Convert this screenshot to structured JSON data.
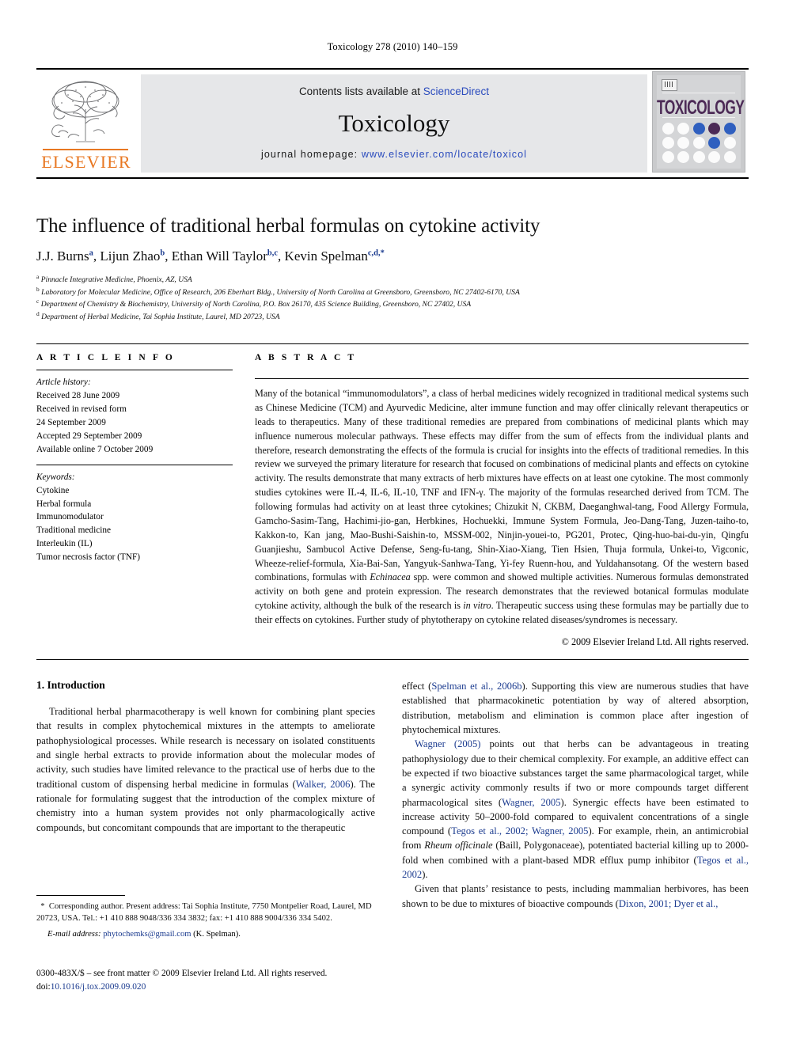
{
  "running_head": "Toxicology 278 (2010) 140–159",
  "masthead": {
    "contents_prefix": "Contents lists available at ",
    "sciencedirect": "ScienceDirect",
    "journal_title": "Toxicology",
    "homepage_prefix": "journal homepage:",
    "homepage_url": "www.elsevier.com/locate/toxicol",
    "publisher_logo_text": "ELSEVIER",
    "cover_title": "TOXICOLOGY",
    "accent_orange": "#E87722",
    "link_blue": "#2a4bbd",
    "cover_plum": "#4c2a56",
    "cover_blue": "#2f5fbf"
  },
  "article": {
    "title": "The influence of traditional herbal formulas on cytokine activity",
    "authors": [
      {
        "name": "J.J. Burns",
        "sup": "a"
      },
      {
        "name": "Lijun Zhao",
        "sup": "b"
      },
      {
        "name": "Ethan Will Taylor",
        "sup": "b,c"
      },
      {
        "name": "Kevin Spelman",
        "sup": "c,d,*"
      }
    ],
    "affiliations": [
      {
        "sup": "a",
        "text": "Pinnacle Integrative Medicine, Phoenix, AZ, USA"
      },
      {
        "sup": "b",
        "text": "Laboratory for Molecular Medicine, Office of Research, 206 Eberhart Bldg., University of North Carolina at Greensboro, Greensboro, NC 27402-6170, USA"
      },
      {
        "sup": "c",
        "text": "Department of Chemistry & Biochemistry, University of North Carolina, P.O. Box 26170, 435 Science Building, Greensboro, NC 27402, USA"
      },
      {
        "sup": "d",
        "text": "Department of Herbal Medicine, Tai Sophia Institute, Laurel, MD 20723, USA"
      }
    ]
  },
  "article_info": {
    "label": "A R T I C L E    I N F O",
    "history_heading": "Article history:",
    "history": [
      "Received 28 June 2009",
      "Received in revised form",
      "24 September 2009",
      "Accepted 29 September 2009",
      "Available online 7 October 2009"
    ],
    "keywords_heading": "Keywords:",
    "keywords": [
      "Cytokine",
      "Herbal formula",
      "Immunomodulator",
      "Traditional medicine",
      "Interleukin (IL)",
      "Tumor necrosis factor (TNF)"
    ]
  },
  "abstract": {
    "label": "A B S T R A C T",
    "p1": "Many of the botanical “immunomodulators”, a class of herbal medicines widely recognized in traditional medical systems such as Chinese Medicine (TCM) and Ayurvedic Medicine, alter immune function and may offer clinically relevant therapeutics or leads to therapeutics. Many of these traditional remedies are prepared from combinations of medicinal plants which may influence numerous molecular pathways. These effects may differ from the sum of effects from the individual plants and therefore, research demonstrating the effects of the formula is crucial for insights into the effects of traditional remedies. In this review we surveyed the primary literature for research that focused on combinations of medicinal plants and effects on cytokine activity. The results demonstrate that many extracts of herb mixtures have effects on at least one cytokine. The most commonly studies cytokines were IL-4, IL-6, IL-10, TNF and IFN-γ. The majority of the formulas researched derived from TCM. The following formulas had activity on at least three cytokines; Chizukit N, CKBM, Daeganghwal-tang, Food Allergy Formula, Gamcho-Sasim-Tang, Hachimi-jio-gan, Herbkines, Hochuekki, Immune System Formula, Jeo-Dang-Tang, Juzen-taiho-to, Kakkon-to, Kan jang, Mao-Bushi-Saishin-to, MSSM-002, Ninjin-youei-to, PG201, Protec, Qing-huo-bai-du-yin, Qingfu Guanjieshu, Sambucol Active Defense, Seng-fu-tang, Shin-Xiao-Xiang, Tien Hsien, Thuja formula, Unkei-to, Vigconic, Wheeze-relief-formula, Xia-Bai-San, Yangyuk-Sanhwa-Tang, Yi-fey Ruenn-hou, and Yuldahansotang. Of the western based combinations, formulas with ",
    "p1_italic": "Echinacea",
    "p1b": " spp. were common and showed multiple activities. Numerous formulas demonstrated activity on both gene and protein expression. The research demonstrates that the reviewed botanical formulas modulate cytokine activity, although the bulk of the research is ",
    "p1_italic2": "in vitro",
    "p1c": ". Therapeutic success using these formulas may be partially due to their effects on cytokines. Further study of phytotherapy on cytokine related diseases/syndromes is necessary.",
    "copyright": "© 2009 Elsevier Ireland Ltd. All rights reserved."
  },
  "body": {
    "section_heading": "1.  Introduction",
    "left_p1_a": "Traditional herbal pharmacotherapy is well known for combining plant species that results in complex phytochemical mixtures in the attempts to ameliorate pathophysiological processes. While research is necessary on isolated constituents and single herbal extracts to provide information about the molecular modes of activity, such studies have limited relevance to the practical use of herbs due to the traditional custom of dispensing herbal medicine in formulas (",
    "left_ref1": "Walker, 2006",
    "left_p1_b": "). The rationale for formulating suggest that the introduction of the complex mixture of chemistry into a human system provides not only pharmacologically active compounds, but concomitant compounds that are important to the therapeutic",
    "right_p1_a": "effect (",
    "right_ref1": "Spelman et al., 2006b",
    "right_p1_b": "). Supporting this view are numerous studies that have established that pharmacokinetic potentiation by way of altered absorption, distribution, metabolism and elimination is common place after ingestion of phytochemical mixtures.",
    "right_ref2": "Wagner (2005)",
    "right_p2_a": " points out that herbs can be advantageous in treating pathophysiology due to their chemical complexity. For example, an additive effect can be expected if two bioactive substances target the same pharmacological target, while a synergic activity commonly results if two or more compounds target different pharmacological sites (",
    "right_ref3": "Wagner, 2005",
    "right_p2_b": "). Synergic effects have been estimated to increase activity 50–2000-fold compared to equivalent concentrations of a single compound (",
    "right_ref4": "Tegos et al., 2002;",
    "right_ref5": "Wagner, 2005",
    "right_p2_c": "). For example, rhein, an antimicrobial from ",
    "right_italic1": "Rheum officinale",
    "right_p2_d": " (Baill, Polygonaceae), potentiated bacterial killing up to 2000-fold when combined with a plant-based MDR efflux pump inhibitor (",
    "right_ref6": "Tegos et al., 2002",
    "right_p2_e": ").",
    "right_p3_a": "Given that plants’ resistance to pests, including mammalian herbivores, has been shown to be due to mixtures of bioactive compounds (",
    "right_ref7": "Dixon, 2001;",
    "right_ref8": "Dyer et al.,",
    "right_p3_b": ""
  },
  "footnotes": {
    "star": "*",
    "corresponding": "Corresponding author. Present address: Tai Sophia Institute, 7750 Montpelier Road, Laurel, MD 20723, USA. Tel.: +1 410 888 9048/336 334 3832; fax: +1 410 888 9004/336 334 5402.",
    "email_label": "E-mail address:",
    "email": "phytochemks@gmail.com",
    "email_suffix": "(K. Spelman).",
    "issn_line": "0300-483X/$ – see front matter © 2009 Elsevier Ireland Ltd. All rights reserved.",
    "doi_label": "doi:",
    "doi": "10.1016/j.tox.2009.09.020"
  }
}
